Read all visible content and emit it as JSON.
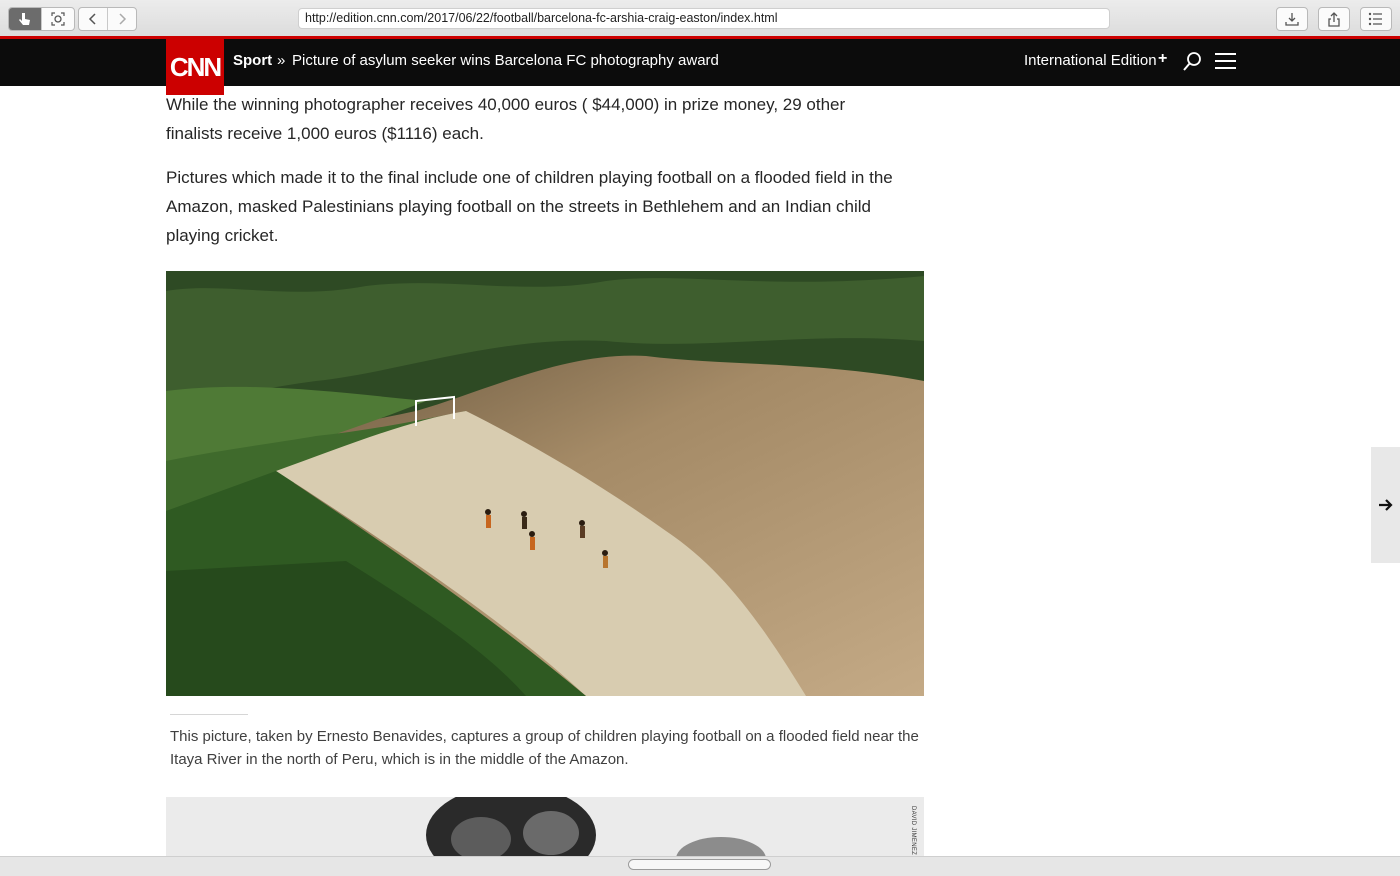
{
  "browser": {
    "url": "http://edition.cnn.com/2017/06/22/football/barcelona-fc-arshia-craig-easton/index.html",
    "icons": [
      "pointer-icon",
      "screenshot-icon",
      "back-icon",
      "forward-icon",
      "download-icon",
      "share-icon",
      "reading-list-icon"
    ]
  },
  "nav": {
    "logo": "CNN",
    "section": "Sport",
    "separator": "»",
    "title": "Picture of asylum seeker wins Barcelona FC photography award",
    "edition": "International Edition",
    "edition_plus": "+",
    "brand_color": "#cc0000"
  },
  "article": {
    "paragraphs": [
      "While the winning photographer receives 40,000 euros ( $44,000) in prize money, 29 other finalists receive 1,000 euros ($1116) each.",
      "Pictures which made it to the final include one of children playing football on a flooded field in the Amazon, masked Palestinians playing football on the streets in Bethlehem and an Indian child playing cricket."
    ],
    "caption": "This picture, taken by Ernesto Benavides, captures a group of children playing football on a flooded field near the Itaya River in the north of Peru, which is in the middle of the Amazon.",
    "second_photo_credit": "DAVID JIMENEZ"
  }
}
